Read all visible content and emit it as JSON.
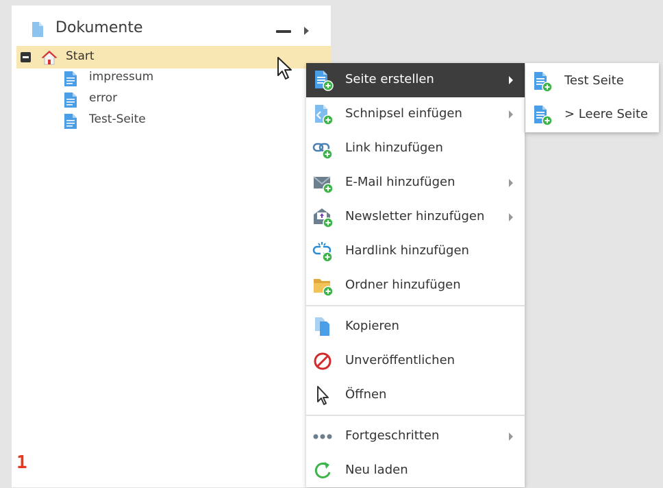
{
  "panel": {
    "title": "Dokumente",
    "header_icon": "document-icon",
    "controls": [
      "collapse-all-icon",
      "arrow-right-icon"
    ]
  },
  "tree": {
    "root": {
      "label": "Start",
      "icon": "home-icon",
      "expanded": true
    },
    "children": [
      {
        "label": "impressum",
        "icon": "page-icon"
      },
      {
        "label": "error",
        "icon": "page-icon"
      },
      {
        "label": "Test-Seite",
        "icon": "page-icon"
      }
    ]
  },
  "context_menu": {
    "items": [
      {
        "label": "Seite erstellen",
        "icon": "page-add-icon",
        "submenu": true,
        "active": true
      },
      {
        "label": "Schnipsel einfügen",
        "icon": "snippet-add-icon",
        "submenu": true
      },
      {
        "label": "Link hinzufügen",
        "icon": "link-add-icon",
        "submenu": false
      },
      {
        "label": "E-Mail hinzufügen",
        "icon": "email-add-icon",
        "submenu": true
      },
      {
        "label": "Newsletter hinzufügen",
        "icon": "newsletter-add-icon",
        "submenu": true
      },
      {
        "label": "Hardlink hinzufügen",
        "icon": "hardlink-add-icon",
        "submenu": false
      },
      {
        "label": "Ordner hinzufügen",
        "icon": "folder-add-icon",
        "submenu": false
      },
      {
        "label": "Kopieren",
        "icon": "copy-icon",
        "submenu": false
      },
      {
        "label": "Unveröffentlichen",
        "icon": "unpublish-icon",
        "submenu": false
      },
      {
        "label": "Öffnen",
        "icon": "cursor-icon",
        "submenu": false
      },
      {
        "label": "Fortgeschritten",
        "icon": "more-icon",
        "submenu": true
      },
      {
        "label": "Neu laden",
        "icon": "reload-icon",
        "submenu": false
      }
    ]
  },
  "submenu": {
    "items": [
      {
        "label": "Test Seite",
        "icon": "page-add-icon"
      },
      {
        "label": "> Leere Seite",
        "icon": "page-add-icon"
      }
    ]
  },
  "annotation": {
    "step": "1"
  },
  "colors": {
    "page_blue": "#4a9ee8",
    "add_green": "#3cb44a",
    "highlight": "#f9e7b3",
    "active_menu": "#3d3d3d",
    "step_red": "#e8391f"
  }
}
